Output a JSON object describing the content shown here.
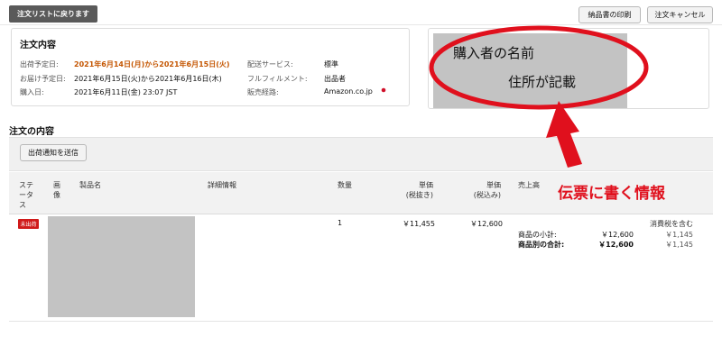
{
  "header": {
    "back_label": "注文リストに戻ります",
    "print_label": "納品書の印刷",
    "cancel_label": "注文キャンセル"
  },
  "summary": {
    "title": "注文内容",
    "ship_date_label": "出荷予定日:",
    "ship_date_value": "2021年6月14日(月)から2021年6月15日(火)",
    "delivery_label": "お届け予定日:",
    "delivery_value": "2021年6月15日(火)から2021年6月16日(木)",
    "purchase_label": "購入日:",
    "purchase_value": "2021年6月11日(金) 23:07 JST",
    "service_label": "配送サービス:",
    "service_value": "標準",
    "fulfillment_label": "フルフィルメント:",
    "fulfillment_value": "出品者",
    "channel_label": "販売経路:",
    "channel_value": "Amazon.co.jp"
  },
  "buyer": {
    "name_note": "購入者の名前",
    "address_note": "住所が記載"
  },
  "order_contents": {
    "title": "注文の内容",
    "send_notice_label": "出荷通知を送信"
  },
  "table": {
    "col_status": "ステータス",
    "col_image": "画像",
    "col_product": "製品名",
    "col_detail": "詳細情報",
    "col_qty": "数量",
    "col_price_ex": "単価",
    "col_price_ex_sub": "(税抜き)",
    "col_price_in": "単価",
    "col_price_in_sub": "(税込み)",
    "col_sales": "売上高",
    "row": {
      "status_badge": "未出荷",
      "qty": "1",
      "price_ex": "￥11,455",
      "price_in": "￥12,600",
      "tax_included": "消費税を含む",
      "subtotal_label": "商品の小計:",
      "subtotal_value": "￥12,600",
      "subtotal_tax": "￥1,145",
      "total_label": "商品別の合計:",
      "total_value": "￥12,600",
      "total_tax": "￥1,145"
    }
  },
  "annotation": {
    "label": "伝票に書く情報",
    "color": "#e0101d"
  }
}
